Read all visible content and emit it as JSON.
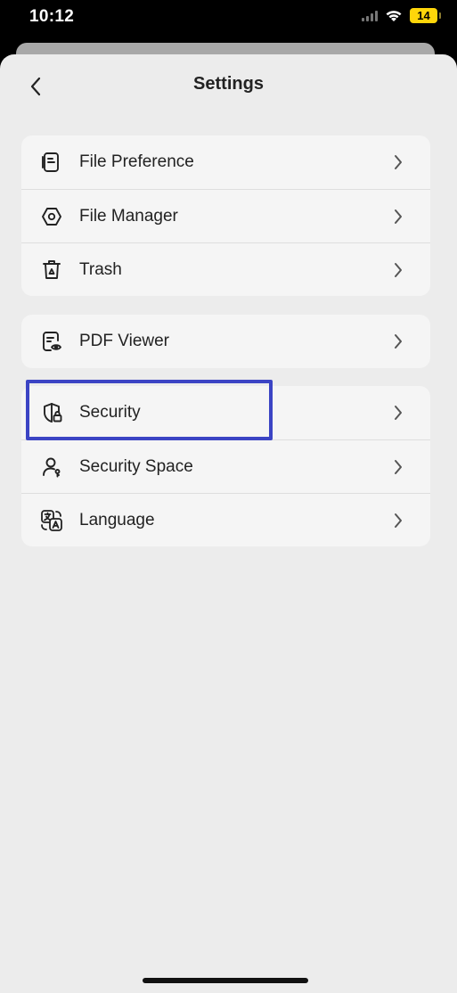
{
  "status_bar": {
    "time": "10:12",
    "battery_level": "14",
    "battery_color": "#ffd60a"
  },
  "header": {
    "title": "Settings",
    "back_icon": "chevron-left-icon"
  },
  "groups": [
    {
      "items": [
        {
          "label": "File Preference",
          "icon": "file-preference-icon"
        },
        {
          "label": "File Manager",
          "icon": "hexagon-icon"
        },
        {
          "label": "Trash",
          "icon": "trash-icon"
        }
      ]
    },
    {
      "items": [
        {
          "label": "PDF Viewer",
          "icon": "pdf-viewer-icon"
        }
      ]
    },
    {
      "items": [
        {
          "label": "Security",
          "icon": "shield-lock-icon",
          "highlighted": true
        },
        {
          "label": "Security Space",
          "icon": "person-lock-icon"
        },
        {
          "label": "Language",
          "icon": "language-icon"
        }
      ]
    }
  ],
  "highlight_color": "#3b44c4"
}
